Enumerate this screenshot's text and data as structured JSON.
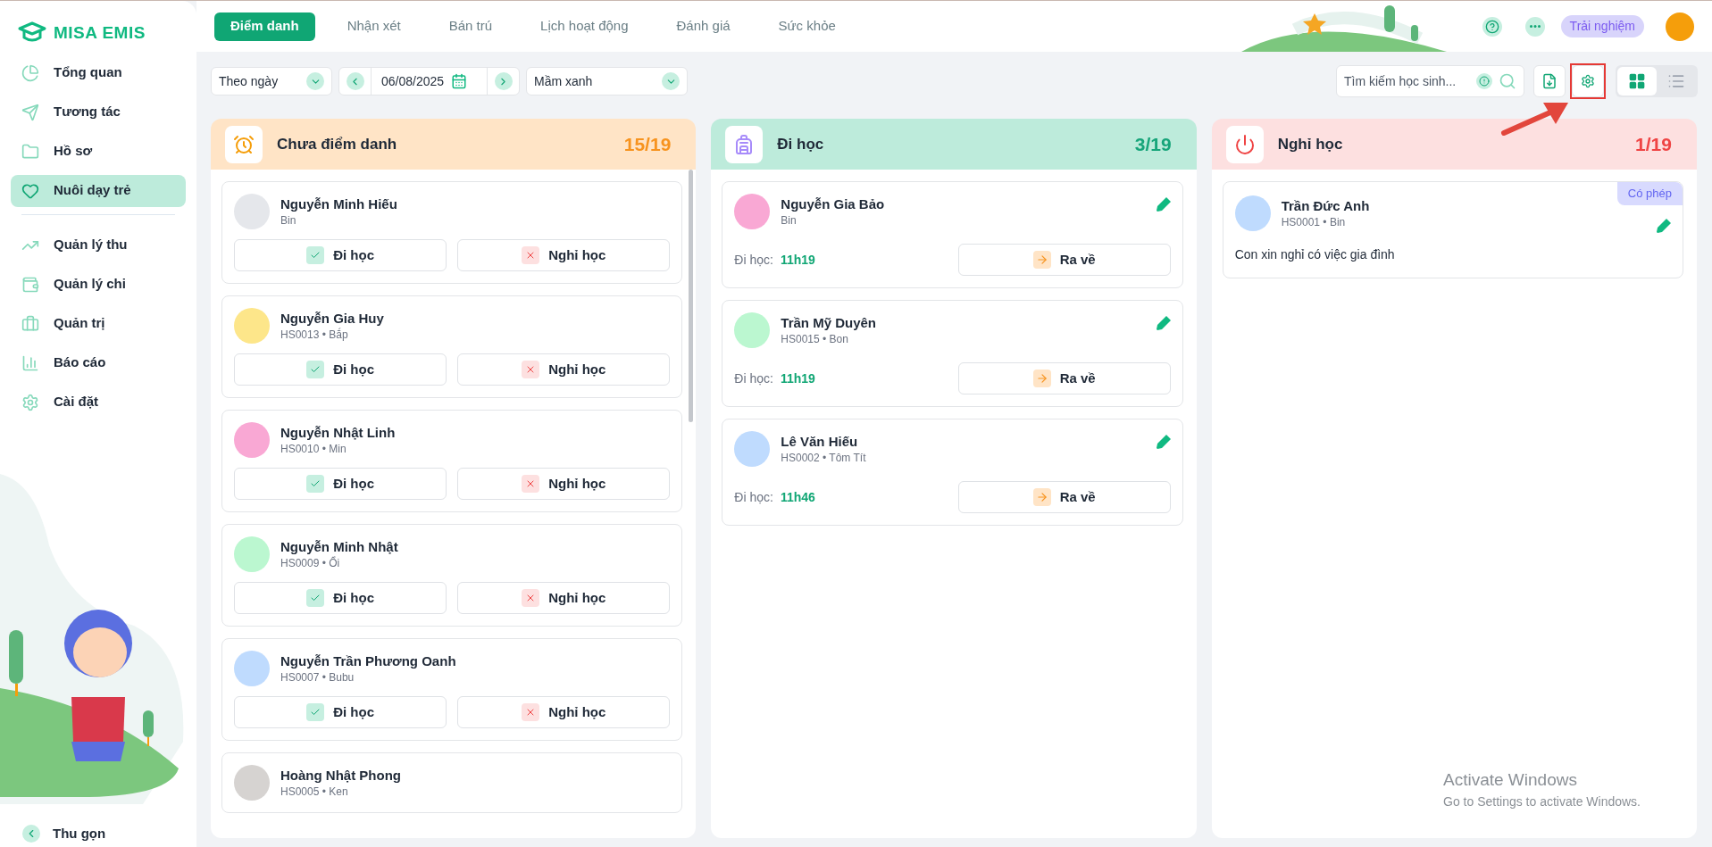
{
  "sidebar": {
    "logo": "MISA EMIS",
    "groups": [
      [
        {
          "label": "Tổng quan",
          "selected": false
        },
        {
          "label": "Tương tác",
          "selected": false
        },
        {
          "label": "Hồ sơ",
          "selected": false
        },
        {
          "label": "Nuôi dạy trẻ",
          "selected": true
        }
      ],
      [
        {
          "label": "Quản lý thu",
          "selected": false
        },
        {
          "label": "Quản lý chi",
          "selected": false
        },
        {
          "label": "Quản trị",
          "selected": false
        },
        {
          "label": "Báo cáo",
          "selected": false
        },
        {
          "label": "Cài đặt",
          "selected": false
        }
      ]
    ],
    "collapse": "Thu gọn"
  },
  "tabs": [
    {
      "label": "Điểm danh",
      "selected": true
    },
    {
      "label": "Nhận xét",
      "selected": false
    },
    {
      "label": "Bán trú",
      "selected": false
    },
    {
      "label": "Lịch hoạt động",
      "selected": false
    },
    {
      "label": "Đánh giá",
      "selected": false
    },
    {
      "label": "Sức khỏe",
      "selected": false
    }
  ],
  "header": {
    "trial": "Trải nghiệm"
  },
  "toolbar": {
    "period": "Theo ngày",
    "date": "06/08/2025",
    "class": "Mầm xanh",
    "search": {
      "placeholder": "Tìm kiếm học sinh..."
    },
    "views": [
      {
        "kind": "grid",
        "selected": true
      },
      {
        "kind": "list",
        "selected": false
      }
    ]
  },
  "columns": [
    {
      "kind": "pending",
      "title": "Chưa điểm danh",
      "count": "15/19",
      "students": [
        {
          "name": "Nguyễn Minh Hiếu",
          "sub": "Bin",
          "actions": [
            "Đi học",
            "Nghỉ học"
          ]
        },
        {
          "name": "Nguyễn Gia Huy",
          "sub": "HS0013 • Bắp",
          "actions": [
            "Đi học",
            "Nghỉ học"
          ]
        },
        {
          "name": "Nguyễn Nhật Linh",
          "sub": "HS0010 • Min",
          "actions": [
            "Đi học",
            "Nghỉ học"
          ]
        },
        {
          "name": "Nguyễn Minh Nhật",
          "sub": "HS0009 • Ổi",
          "actions": [
            "Đi học",
            "Nghỉ học"
          ]
        },
        {
          "name": "Nguyễn Trần Phương Oanh",
          "sub": "HS0007 • Bubu",
          "actions": [
            "Đi học",
            "Nghỉ học"
          ]
        },
        {
          "name": "Hoàng Nhật Phong",
          "sub": "HS0005 • Ken"
        }
      ]
    },
    {
      "kind": "present",
      "title": "Đi học",
      "count": "3/19",
      "students": [
        {
          "name": "Nguyễn Gia Bảo",
          "sub": "Bin",
          "time_label": "Đi học:",
          "time": "11h19",
          "action": "Ra về"
        },
        {
          "name": "Trần Mỹ Duyên",
          "sub": "HS0015 • Bon",
          "time_label": "Đi học:",
          "time": "11h19",
          "action": "Ra về"
        },
        {
          "name": "Lê Văn Hiếu",
          "sub": "HS0002 • Tôm Tít",
          "time_label": "Đi học:",
          "time": "11h46",
          "action": "Ra về"
        }
      ]
    },
    {
      "kind": "absent",
      "title": "Nghỉ học",
      "count": "1/19",
      "students": [
        {
          "name": "Trần Đức Anh",
          "sub": "HS0001 • Bin",
          "badge": "Có phép",
          "note": "Con xin nghỉ có việc gia đình"
        }
      ]
    }
  ],
  "os_overlay": {
    "title": "Activate Windows",
    "subtitle": "Go to Settings to activate Windows."
  }
}
